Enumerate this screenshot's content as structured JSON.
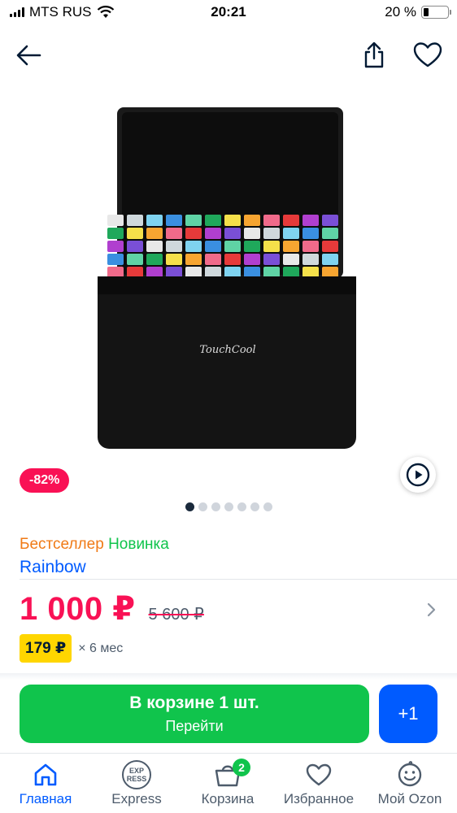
{
  "status_bar": {
    "carrier": "MTS RUS",
    "time": "20:21",
    "battery": "20 %",
    "battery_level": 0.2
  },
  "nav": {
    "back_icon": "arrow-left-icon",
    "share_icon": "share-icon",
    "favorite_icon": "heart-icon"
  },
  "gallery": {
    "discount": "-82%",
    "image_count": 7,
    "active_index": 0,
    "brand_on_case": "TouchCool"
  },
  "product": {
    "labels": {
      "bestseller": "Бестселлер",
      "new": "Новинка"
    },
    "brand": "Rainbow",
    "price": "1 000 ₽",
    "old_price": "5 600 ₽",
    "installment_price": "179 ₽",
    "installment_term": "× 6 мес"
  },
  "cart_action": {
    "title": "В корзине 1 шт.",
    "subtitle": "Перейти",
    "plus_label": "+1"
  },
  "tab_bar": {
    "items": [
      {
        "label": "Главная",
        "icon": "home-icon",
        "active": true
      },
      {
        "label": "Express",
        "icon": "express-icon",
        "active": false
      },
      {
        "label": "Корзина",
        "icon": "cart-icon",
        "active": false,
        "badge": "2"
      },
      {
        "label": "Избранное",
        "icon": "heart-icon",
        "active": false
      },
      {
        "label": "Мой Ozon",
        "icon": "smiley-icon",
        "active": false
      }
    ]
  },
  "colors": {
    "accent_blue": "#005bff",
    "price_red": "#f91155",
    "green": "#10c44c",
    "installment_yellow": "#ffd600"
  }
}
